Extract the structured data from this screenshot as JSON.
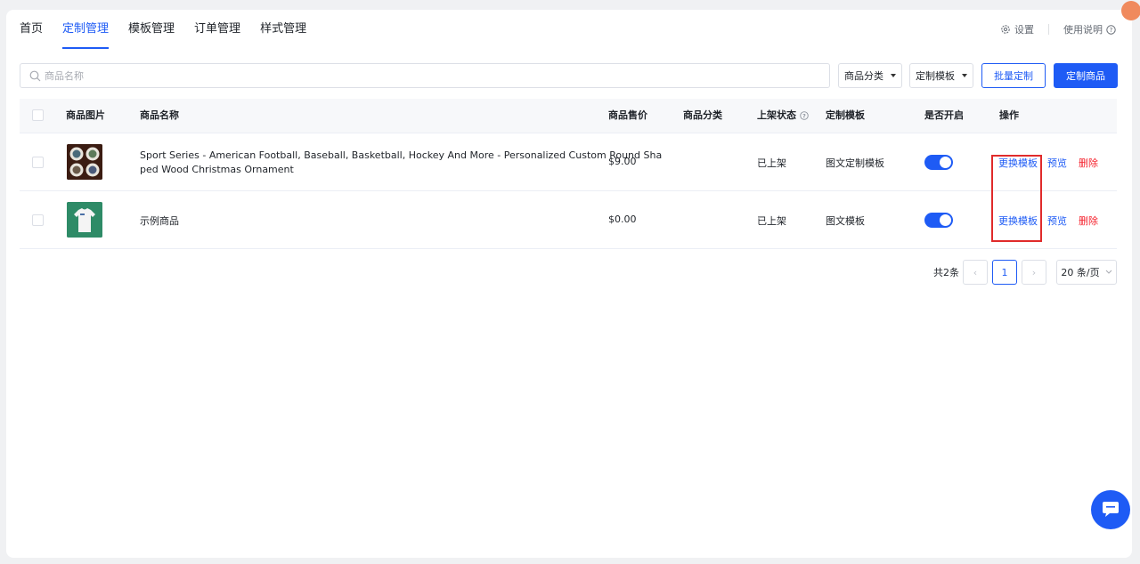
{
  "nav": {
    "tabs": [
      {
        "label": "首页"
      },
      {
        "label": "定制管理"
      },
      {
        "label": "模板管理"
      },
      {
        "label": "订单管理"
      },
      {
        "label": "样式管理"
      }
    ],
    "active_tab": "定制管理",
    "settings_label": "设置",
    "help_label": "使用说明"
  },
  "toolbar": {
    "search_placeholder": "商品名称",
    "category_dropdown": "商品分类",
    "template_dropdown": "定制模板",
    "batch_button": "批量定制",
    "custom_button": "定制商品"
  },
  "table": {
    "headers": {
      "image": "商品图片",
      "name": "商品名称",
      "price": "商品售价",
      "category": "商品分类",
      "status": "上架状态",
      "template": "定制模板",
      "enabled": "是否开启",
      "actions": "操作"
    },
    "rows": [
      {
        "name_line1": "Sport Series - American Football, Baseball, Basketball, Hockey And More - Personalized Custom Round Sha",
        "name_line2": "ped Wood Christmas Ornament",
        "price": "$9.00",
        "category": "",
        "status": "已上架",
        "template": "图文定制模板",
        "enabled": true,
        "thumb": "ornament-image"
      },
      {
        "name_line1": "示例商品",
        "name_line2": "",
        "price": "$0.00",
        "category": "",
        "status": "已上架",
        "template": "图文模板",
        "enabled": true,
        "thumb": "tshirt-image"
      }
    ],
    "actions": {
      "change": "更换模板",
      "preview": "预览",
      "delete": "删除"
    }
  },
  "pagination": {
    "total": "共2条",
    "current_page": "1",
    "page_size": "20 条/页"
  },
  "colors": {
    "accent": "#1e5bf5",
    "danger": "#f5222d",
    "highlight": "#e02b2b"
  }
}
